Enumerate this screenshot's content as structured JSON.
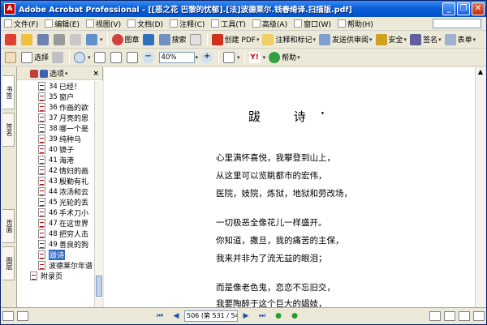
{
  "window": {
    "title": "Adobe Acrobat Professional - [[恶之花 巴黎的忧郁].[法]波德莱尔.钱春绮译.扫描版.pdf]",
    "app_icon": "acrobat-icon",
    "controls": {
      "minimize": "_",
      "restore": "❐",
      "close": "✕"
    }
  },
  "menubar": {
    "items": [
      "文件(F)",
      "编辑(E)",
      "视图(V)",
      "文档(D)",
      "注释(C)",
      "工具(T)",
      "高级(A)",
      "窗口(W)",
      "帮助(H)"
    ]
  },
  "toolbar1": {
    "snapshot_label": "图章",
    "search_label": "搜索",
    "create_pdf_label": "创建 PDF",
    "comment_label": "注释和标记",
    "review_label": "发送供审阅",
    "secure_label": "安全",
    "sign_label": "签名",
    "forms_label": "表单"
  },
  "toolbar2": {
    "select_label": "选择",
    "zoom_value": "40%",
    "help_label": "帮助"
  },
  "left_tabs": [
    "书签",
    "签名",
    "页面",
    "图层"
  ],
  "bookmarks": {
    "options_label": "选项",
    "close_label": "×",
    "items": [
      {
        "num": "34",
        "label": "已经！"
      },
      {
        "num": "35",
        "label": "窗户"
      },
      {
        "num": "36",
        "label": "作画的欲"
      },
      {
        "num": "37",
        "label": "月亮的恩"
      },
      {
        "num": "38",
        "label": "哪一个是"
      },
      {
        "num": "39",
        "label": "纯种马"
      },
      {
        "num": "40",
        "label": "镜子"
      },
      {
        "num": "41",
        "label": "海港"
      },
      {
        "num": "42",
        "label": "情妇的画"
      },
      {
        "num": "43",
        "label": "殷勤有礼"
      },
      {
        "num": "44",
        "label": "浓汤和云"
      },
      {
        "num": "45",
        "label": "光轮的丢"
      },
      {
        "num": "46",
        "label": "手术刀小"
      },
      {
        "num": "47",
        "label": "在这世界"
      },
      {
        "num": "48",
        "label": "把穷人击"
      },
      {
        "num": "49",
        "label": "善良的狗"
      },
      {
        "num": "",
        "label": "跋诗",
        "selected": true
      },
      {
        "num": "",
        "label": "波德莱尔年谱"
      }
    ],
    "appendix": "附录页"
  },
  "document": {
    "title": "跋 诗",
    "title_mark": "•",
    "lines": [
      "心里满怀喜悦，我攀登到山上，",
      "从这里可以览眺都市的宏伟，",
      "医院，妓院，炼狱，地狱和劳改场，",
      "",
      "一切极恶全像花儿一样盛开。",
      "你知道，撒旦，我的痛苦的主保，",
      "我来并非为了流无益的眼泪；",
      "",
      "而是像老色鬼，恋恋不忘旧交，",
      "我要陶醉于这个巨大的娼妓，"
    ]
  },
  "statusbar": {
    "page_value": "506 (第 531 / 544 页)"
  }
}
